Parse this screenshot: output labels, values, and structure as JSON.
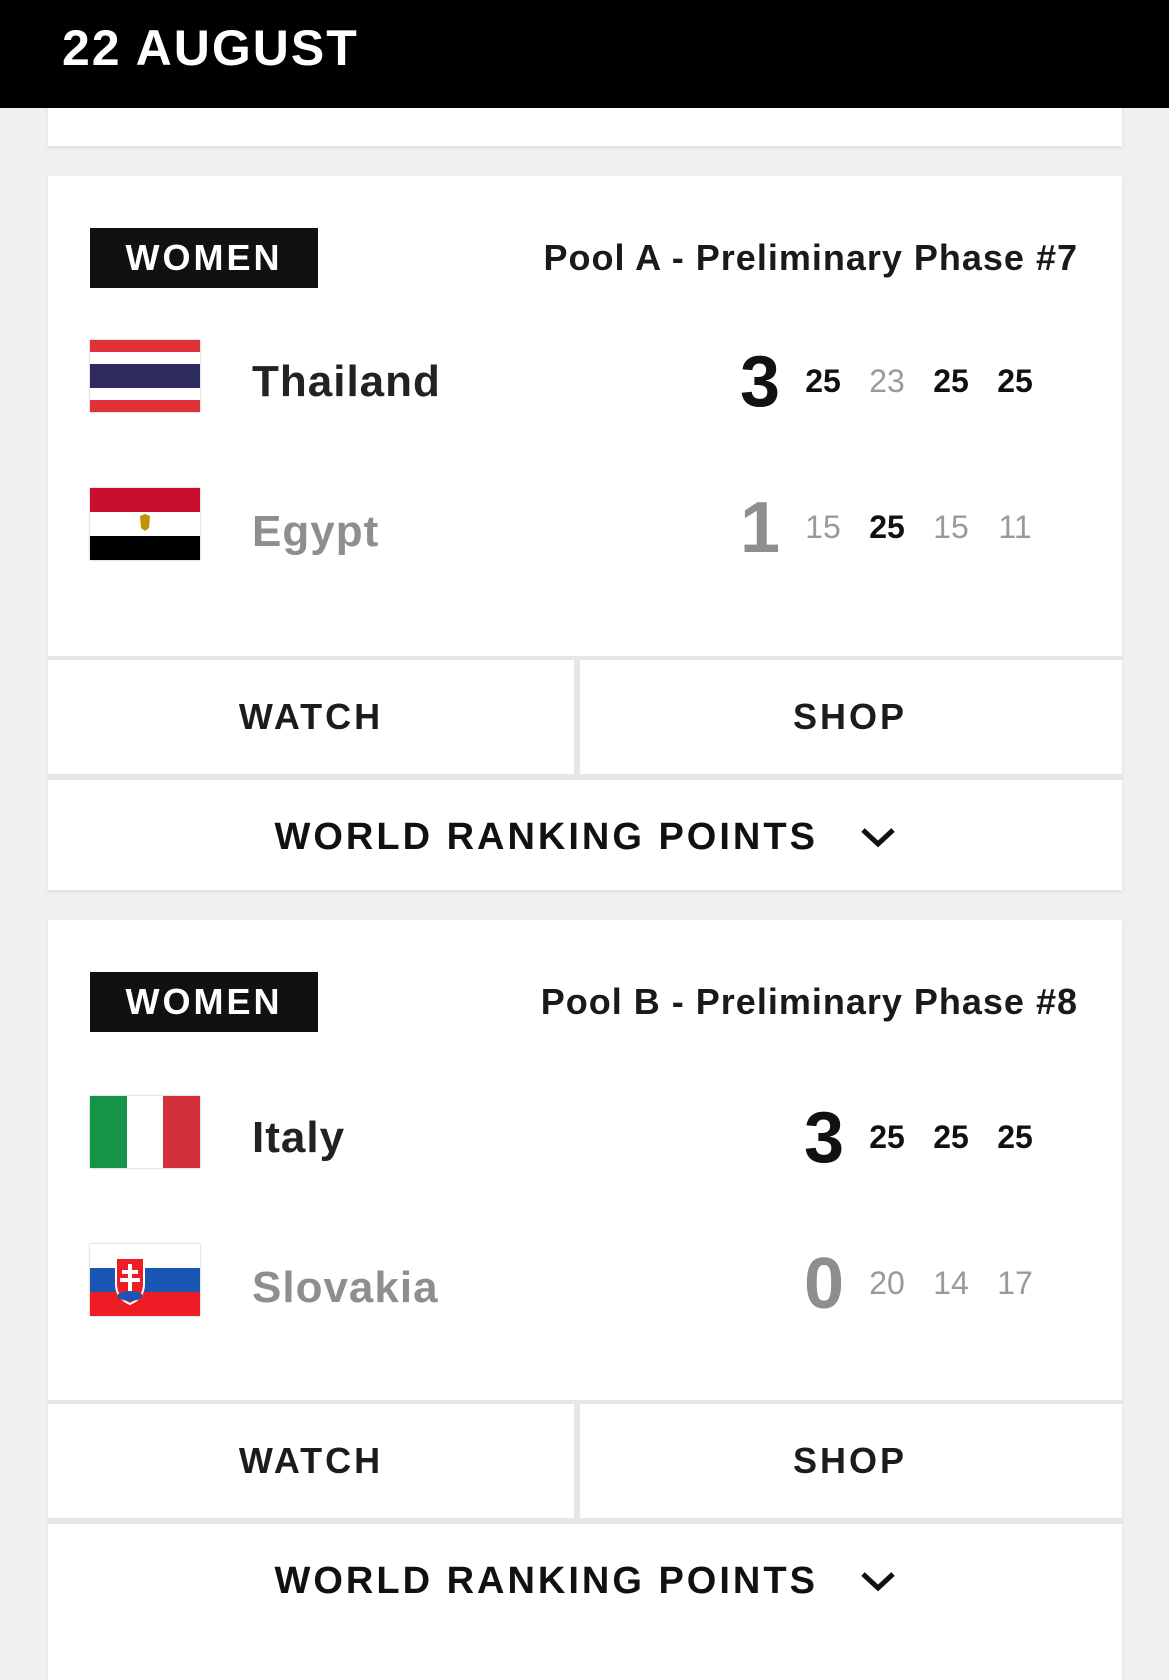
{
  "header": {
    "date": "22 AUGUST"
  },
  "matches": [
    {
      "category": "WOMEN",
      "phase": "Pool A - Preliminary Phase #7",
      "teams": [
        {
          "name": "Thailand",
          "flag": "thailand-flag",
          "total": "3",
          "sets": [
            "25",
            "23",
            "25",
            "25"
          ],
          "won_sets": [
            true,
            false,
            true,
            true
          ],
          "winner": true
        },
        {
          "name": "Egypt",
          "flag": "egypt-flag",
          "total": "1",
          "sets": [
            "15",
            "25",
            "15",
            "11"
          ],
          "won_sets": [
            false,
            true,
            false,
            false
          ],
          "winner": false
        }
      ],
      "watch_label": "WATCH",
      "shop_label": "SHOP",
      "ranking_label": "WORLD RANKING POINTS"
    },
    {
      "category": "WOMEN",
      "phase": "Pool B - Preliminary Phase #8",
      "teams": [
        {
          "name": "Italy",
          "flag": "italy-flag",
          "total": "3",
          "sets": [
            "25",
            "25",
            "25"
          ],
          "won_sets": [
            true,
            true,
            true
          ],
          "winner": true
        },
        {
          "name": "Slovakia",
          "flag": "slovakia-flag",
          "total": "0",
          "sets": [
            "20",
            "14",
            "17"
          ],
          "won_sets": [
            false,
            false,
            false
          ],
          "winner": false
        }
      ],
      "watch_label": "WATCH",
      "shop_label": "SHOP",
      "ranking_label": "WORLD RANKING POINTS"
    }
  ],
  "colors": {
    "header_bg": "#000000",
    "badge_bg": "#111111",
    "winner_text": "#111111",
    "loser_text": "#8e8e8e",
    "page_bg": "#f0f0f0"
  }
}
